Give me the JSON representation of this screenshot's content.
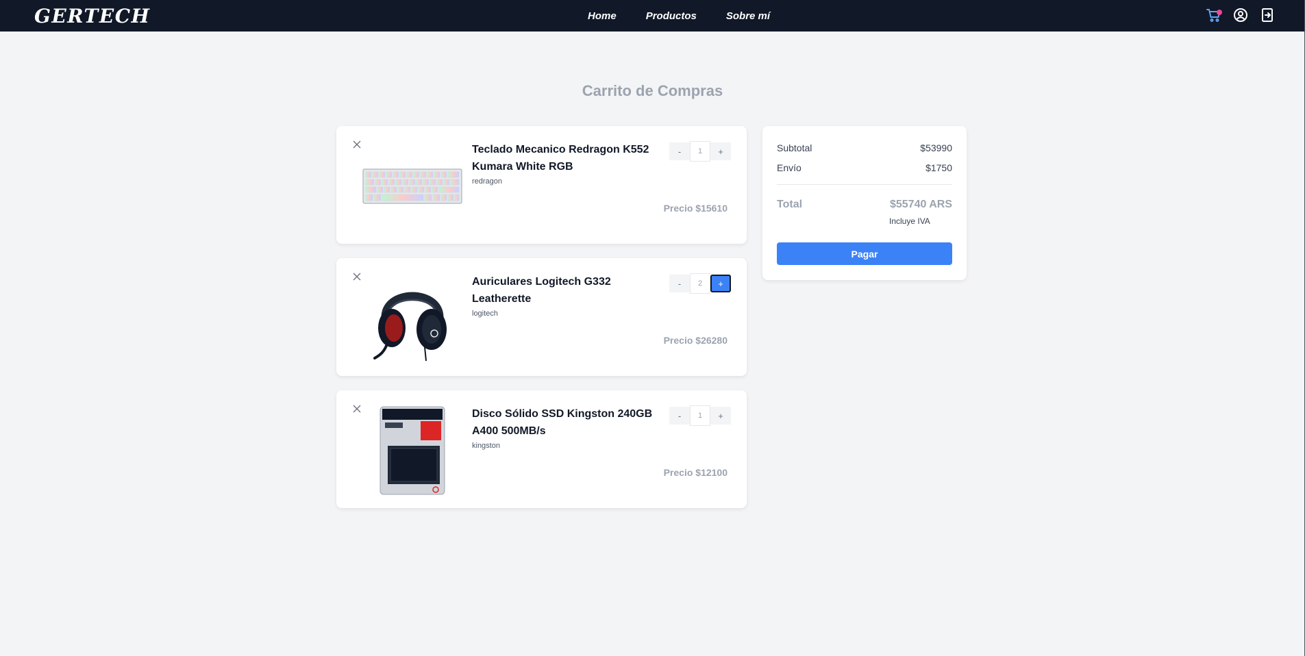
{
  "nav": {
    "brand": "GERTECH",
    "links": [
      "Home",
      "Productos",
      "Sobre mí"
    ],
    "icons": [
      "cart-icon",
      "user-icon",
      "logout-icon"
    ]
  },
  "page": {
    "title": "Carrito de Compras"
  },
  "cart": {
    "items": [
      {
        "name": "Teclado Mecanico Redragon K552 Kumara White RGB",
        "brand": "redragon",
        "qty": "1",
        "qty_minus": "-",
        "qty_plus": "+",
        "price": "Precio $15610",
        "image": "keyboard"
      },
      {
        "name": "Auriculares Logitech G332 Leatherette",
        "brand": "logitech",
        "qty": "2",
        "qty_minus": "-",
        "qty_plus": "+",
        "price": "Precio $26280",
        "image": "headset"
      },
      {
        "name": "Disco Sólido SSD Kingston 240GB A400 500MB/s",
        "brand": "kingston",
        "qty": "1",
        "qty_minus": "-",
        "qty_plus": "+",
        "price": "Precio $12100",
        "image": "ssd"
      }
    ]
  },
  "summary": {
    "subtotal_label": "Subtotal",
    "subtotal_value": "$53990",
    "shipping_label": "Envío",
    "shipping_value": "$1750",
    "total_label": "Total",
    "total_value": "$55740 ARS",
    "tax_note": "Incluye IVA",
    "pay_label": "Pagar"
  },
  "colors": {
    "nav_bg": "#111827",
    "page_bg": "#f3f4f6",
    "accent": "#3b82f6",
    "cart_badge": "#ec4899",
    "muted": "#9ca3af"
  }
}
